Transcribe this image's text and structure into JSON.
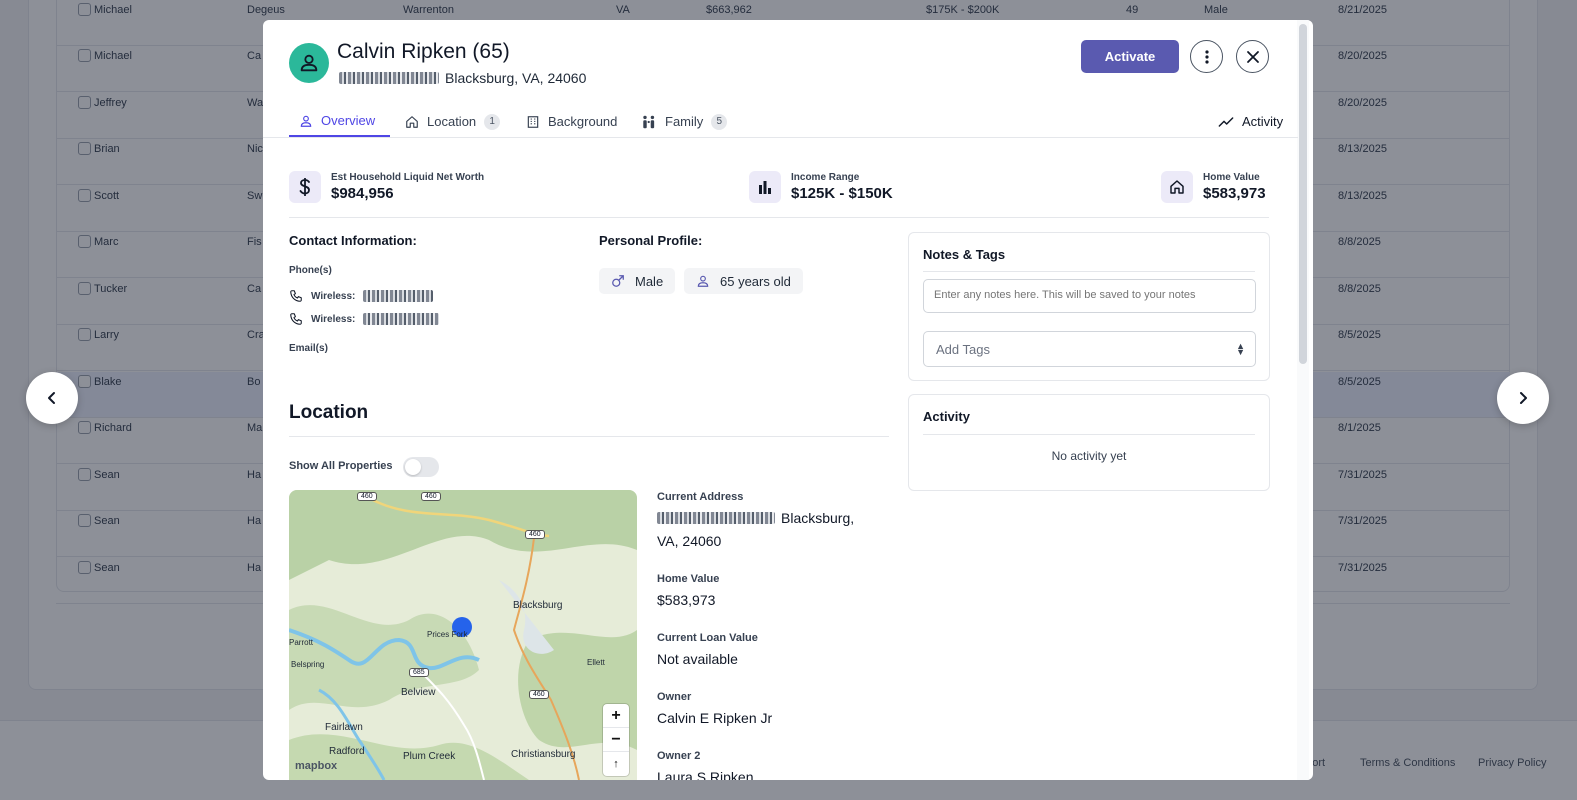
{
  "background": {
    "rows": [
      {
        "first": "Michael",
        "last": "Degeus",
        "city": "Warrenton",
        "state": "VA",
        "value": "$663,962",
        "income": "$175K - $200K",
        "age": "49",
        "gender": "Male",
        "date": "8/21/2025"
      },
      {
        "first": "Michael",
        "last": "Ca",
        "date": "8/20/2025"
      },
      {
        "first": "Jeffrey",
        "last": "Wa",
        "date": "8/20/2025"
      },
      {
        "first": "Brian",
        "last": "Nic",
        "date": "8/13/2025"
      },
      {
        "first": "Scott",
        "last": "Sw",
        "date": "8/13/2025"
      },
      {
        "first": "Marc",
        "last": "Fis",
        "date": "8/8/2025"
      },
      {
        "first": "Tucker",
        "last": "Ca",
        "date": "8/8/2025"
      },
      {
        "first": "Larry",
        "last": "Cra",
        "date": "8/5/2025"
      },
      {
        "first": "Blake",
        "last": "Bo",
        "date": "8/5/2025"
      },
      {
        "first": "Richard",
        "last": "Ma",
        "date": "8/1/2025"
      },
      {
        "first": "Sean",
        "last": "Ha",
        "date": "7/31/2025"
      },
      {
        "first": "Sean",
        "last": "Ha",
        "date": "7/31/2025"
      },
      {
        "first": "Sean",
        "last": "Ha",
        "date": "7/31/2025"
      }
    ],
    "footer": {
      "support": "pport",
      "terms": "Terms & Conditions",
      "privacy": "Privacy Policy"
    }
  },
  "profile": {
    "name": "Calvin Ripken (65)",
    "address_suffix": "Blacksburg, VA, 24060",
    "activate_label": "Activate"
  },
  "tabs": [
    {
      "label": "Overview",
      "icon": "user-icon"
    },
    {
      "label": "Location",
      "badge": "1",
      "icon": "home-icon"
    },
    {
      "label": "Background",
      "icon": "building-icon"
    },
    {
      "label": "Family",
      "badge": "5",
      "icon": "family-icon"
    },
    {
      "label": "Activity",
      "icon": "trend-icon"
    }
  ],
  "stats": {
    "net_worth_label": "Est Household Liquid Net Worth",
    "net_worth": "$984,956",
    "income_label": "Income Range",
    "income": "$125K - $150K",
    "home_label": "Home Value",
    "home": "$583,973"
  },
  "contact": {
    "title": "Contact Information:",
    "phones_label": "Phone(s)",
    "phone1_label": "Wireless:",
    "phone2_label": "Wireless:",
    "emails_label": "Email(s)"
  },
  "personal": {
    "title": "Personal Profile:",
    "gender": "Male",
    "age": "65 years old"
  },
  "notes": {
    "title": "Notes & Tags",
    "placeholder": "Enter any notes here. This will be saved to your notes",
    "tags_placeholder": "Add Tags"
  },
  "activity": {
    "title": "Activity",
    "empty": "No activity yet"
  },
  "location": {
    "title": "Location",
    "toggle_label": "Show All Properties",
    "current_address_label": "Current Address",
    "current_address_suffix": "Blacksburg,",
    "current_address_line2": "VA, 24060",
    "home_value_label": "Home Value",
    "home_value": "$583,973",
    "loan_label": "Current Loan Value",
    "loan_value": "Not available",
    "owner_label": "Owner",
    "owner_value": "Calvin E Ripken Jr",
    "owner2_label": "Owner 2",
    "owner2_value": "Laura S Ripken"
  },
  "map": {
    "labels": [
      "Blacksburg",
      "Prices Fork",
      "Parrott",
      "Belspring",
      "Belview",
      "Ellett",
      "Fairlawn",
      "Radford",
      "Plum Creek",
      "Christiansburg"
    ],
    "shields": [
      "460",
      "460",
      "460",
      "685",
      "460"
    ],
    "attribution": "mapbox",
    "zoom_in": "+",
    "zoom_out": "−",
    "compass": "↑"
  }
}
